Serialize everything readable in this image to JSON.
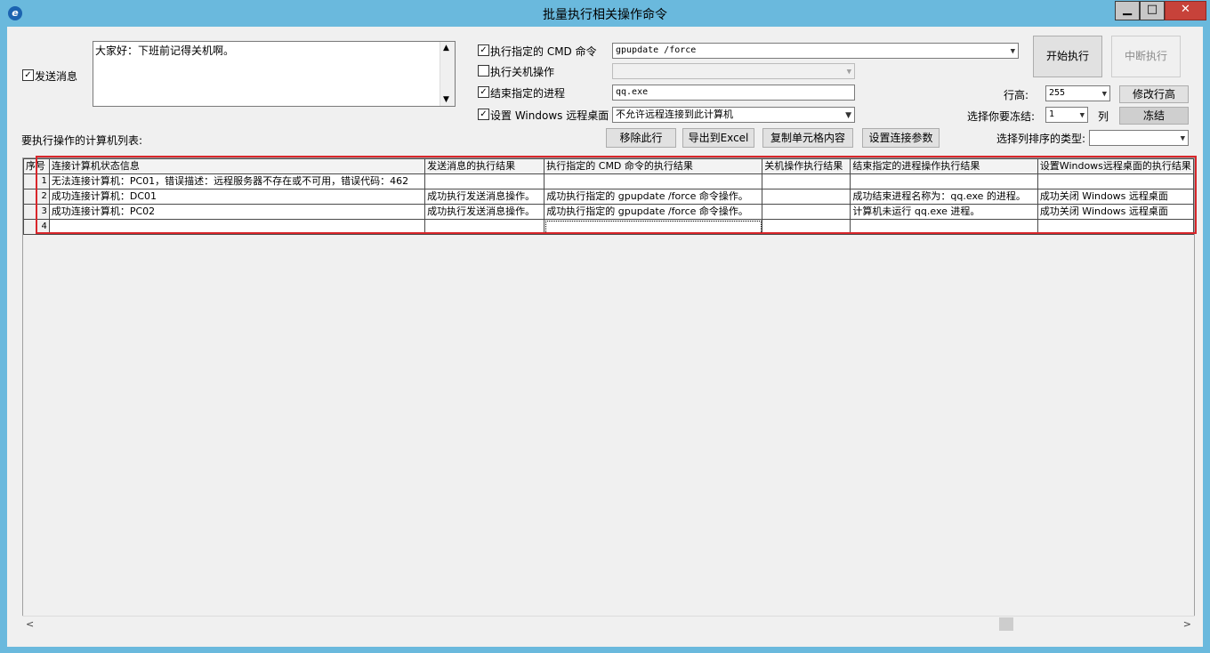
{
  "window": {
    "title": "批量执行相关操作命令",
    "icon": "app-logo-icon"
  },
  "send_message": {
    "label": "发送消息",
    "checked": true,
    "text": "大家好：下班前记得关机啊。"
  },
  "options": {
    "cmd": {
      "label": "执行指定的 CMD 命令",
      "checked": true,
      "value": "gpupdate /force"
    },
    "shutdown": {
      "label": "执行关机操作",
      "checked": false,
      "value": ""
    },
    "kill_process": {
      "label": "结束指定的进程",
      "checked": true,
      "value": "qq.exe"
    },
    "remote_desktop": {
      "label": "设置 Windows 远程桌面",
      "checked": true,
      "value": "不允许远程连接到此计算机"
    }
  },
  "buttons": {
    "start": "开始执行",
    "stop": "中断执行",
    "modify_row_height": "修改行高",
    "freeze": "冻结",
    "remove_row": "移除此行",
    "export_excel": "导出到Excel",
    "copy_cell": "复制单元格内容",
    "connection_params": "设置连接参数"
  },
  "row_height": {
    "label": "行高:",
    "value": "255"
  },
  "freeze": {
    "label": "选择你要冻结:",
    "value": "1",
    "unit": "列"
  },
  "sort_type": {
    "label": "选择列排序的类型:",
    "value": ""
  },
  "list_label": "要执行操作的计算机列表:",
  "grid": {
    "headers": [
      "序号",
      "连接计算机状态信息",
      "发送消息的执行结果",
      "执行指定的 CMD 命令的执行结果",
      "关机操作执行结果",
      "结束指定的进程操作执行结果",
      "设置Windows远程桌面的执行结果"
    ],
    "rows": [
      [
        "1",
        "无法连接计算机：PC01，错误描述：远程服务器不存在或不可用，错误代码：462",
        "",
        "",
        "",
        "",
        ""
      ],
      [
        "2",
        "成功连接计算机：DC01",
        "成功执行发送消息操作。",
        "成功执行指定的 gpupdate /force 命令操作。",
        "",
        "成功结束进程名称为：qq.exe 的进程。",
        "成功关闭 Windows 远程桌面"
      ],
      [
        "3",
        "成功连接计算机：PC02",
        "成功执行发送消息操作。",
        "成功执行指定的 gpupdate /force 命令操作。",
        "",
        "计算机未运行 qq.exe 进程。",
        "成功关闭 Windows 远程桌面"
      ],
      [
        "4",
        "",
        "",
        "",
        "",
        "",
        ""
      ]
    ]
  }
}
